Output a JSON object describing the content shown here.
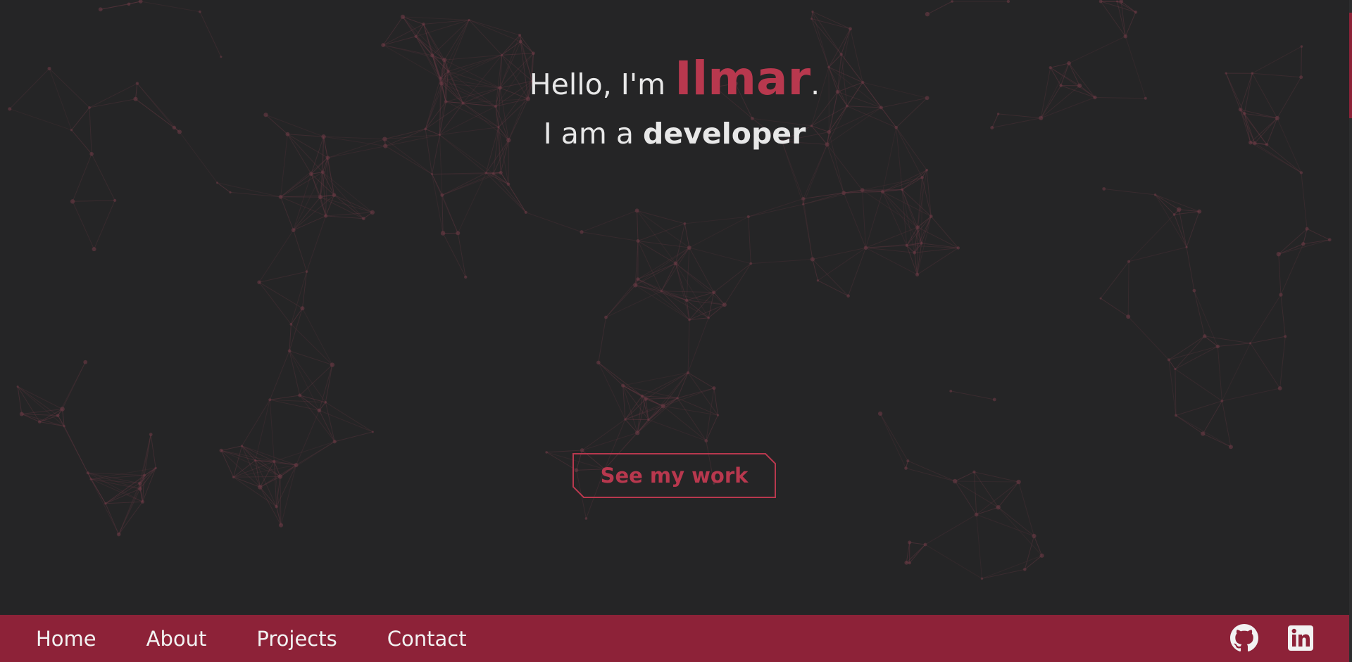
{
  "hero": {
    "greeting": "Hello, I'm ",
    "name": "Ilmar",
    "period": ".",
    "role_prefix": "I am a ",
    "role": "developer"
  },
  "cta": {
    "label": "See my work"
  },
  "nav": {
    "items": [
      {
        "label": "Home"
      },
      {
        "label": "About"
      },
      {
        "label": "Projects"
      },
      {
        "label": "Contact"
      }
    ]
  },
  "social": {
    "icons": [
      "github-icon",
      "linkedin-icon"
    ]
  },
  "colors": {
    "background": "#252526",
    "accent": "#b8384e",
    "navbar": "#8d2238",
    "text": "#e8e8e8",
    "network_line": "#6b3a45"
  }
}
